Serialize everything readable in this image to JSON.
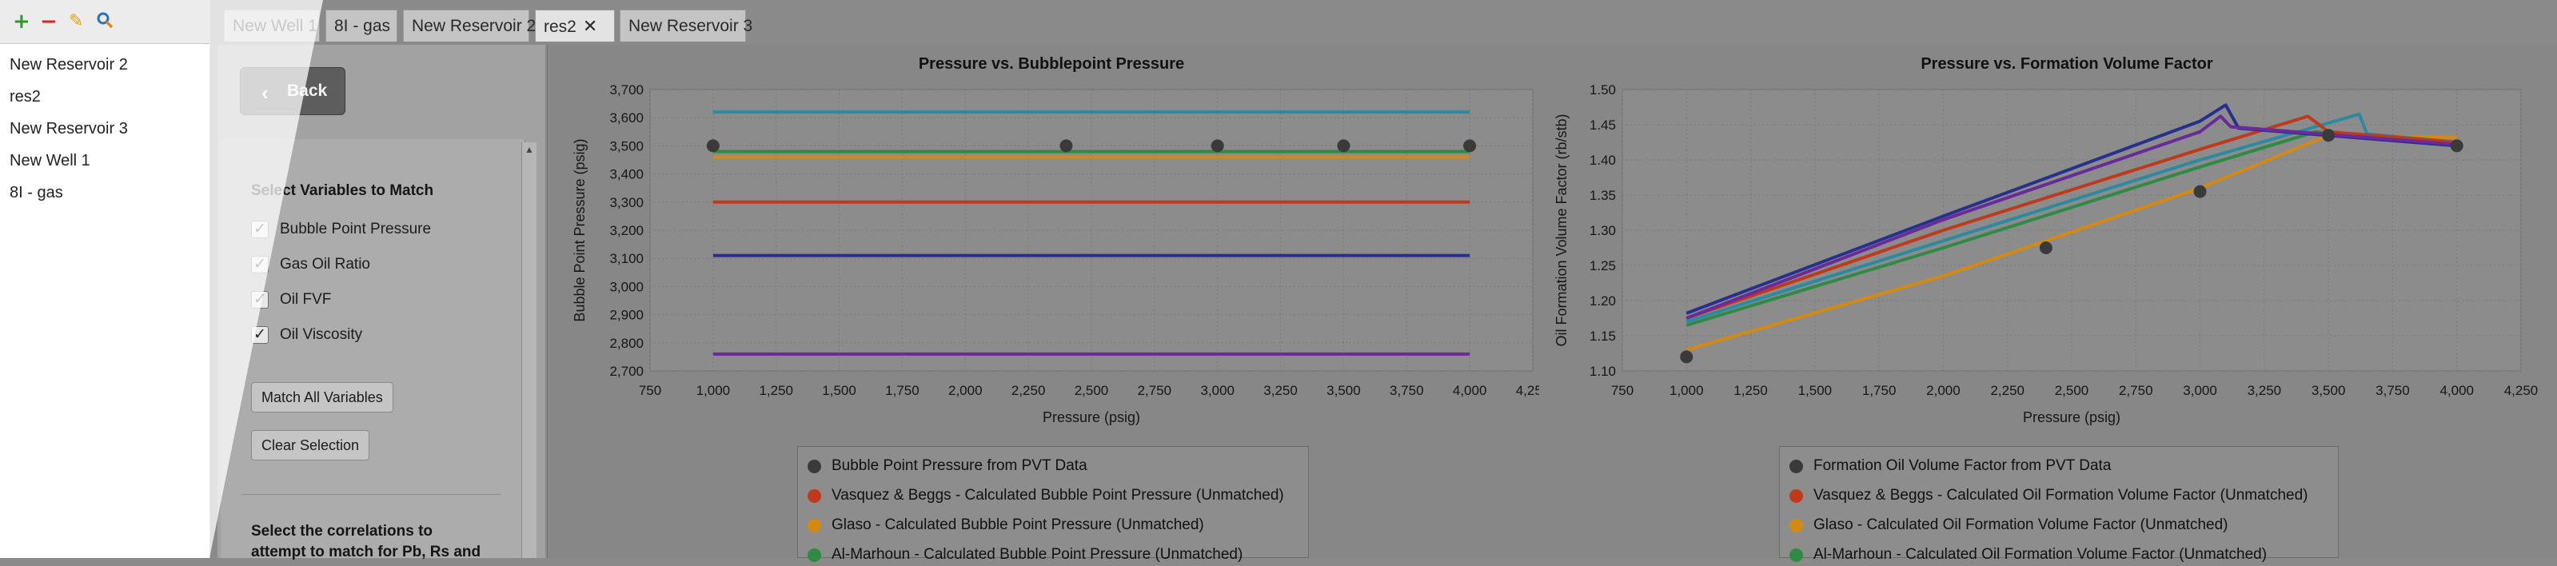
{
  "toolbar": {
    "add_icon": "plus-icon",
    "remove_icon": "minus-icon",
    "edit_icon": "pencil-icon",
    "search_icon": "search-icon"
  },
  "tree": {
    "items": [
      "New Reservoir 2",
      "res2",
      "New Reservoir 3",
      "New Well 1",
      "8I - gas"
    ]
  },
  "tabs": [
    {
      "label": "New Well 1",
      "active": false
    },
    {
      "label": "8I - gas",
      "active": false
    },
    {
      "label": "New Reservoir 2",
      "active": false
    },
    {
      "label": "res2",
      "active": true,
      "close": "✕"
    },
    {
      "label": "New Reservoir 3",
      "active": false
    }
  ],
  "side": {
    "back_label": "Back",
    "select_title": "Select Variables to Match",
    "checkboxes": [
      {
        "label": "Bubble Point Pressure",
        "checked": true
      },
      {
        "label": "Gas Oil Ratio",
        "checked": true
      },
      {
        "label": "Oil FVF",
        "checked": true
      },
      {
        "label": "Oil Viscosity",
        "checked": true
      }
    ],
    "match_all_label": "Match All Variables",
    "clear_label": "Clear Selection",
    "correlations_title_1": "Select the correlations to",
    "correlations_title_2": "attempt to match for Pb, Rs and"
  },
  "colors": {
    "pvt": "#3a3a3a",
    "vasquez": "#c0391b",
    "glaso": "#d48a12",
    "al_marhoun": "#2f8a45",
    "standing": "#2c8aa0",
    "lasater": "#27308d",
    "petrosky": "#6a2a9a"
  },
  "chart_data": [
    {
      "type": "line",
      "title": "Pressure vs. Bubblepoint Pressure",
      "xlabel": "Pressure (psig)",
      "ylabel": "Bubble Point Pressure (psig)",
      "xlim": [
        750,
        4250
      ],
      "ylim": [
        2700,
        3700
      ],
      "xticks": [
        750,
        1000,
        1250,
        1500,
        1750,
        2000,
        2250,
        2500,
        2750,
        3000,
        3250,
        3500,
        3750,
        4000,
        4250
      ],
      "yticks": [
        2700,
        2800,
        2900,
        3000,
        3100,
        3200,
        3300,
        3400,
        3500,
        3600,
        3700
      ],
      "grid": true,
      "points": {
        "name": "Bubble Point Pressure from PVT Data",
        "x": [
          1000,
          2400,
          3000,
          3500,
          4000
        ],
        "y": [
          3500,
          3500,
          3500,
          3500,
          3500
        ]
      },
      "series": [
        {
          "color_key": "standing",
          "x": [
            1000,
            4000
          ],
          "y": [
            3620,
            3620
          ]
        },
        {
          "color_key": "al_marhoun",
          "x": [
            1000,
            4000
          ],
          "y": [
            3480,
            3480
          ]
        },
        {
          "color_key": "glaso",
          "x": [
            1000,
            4000
          ],
          "y": [
            3460,
            3460
          ]
        },
        {
          "color_key": "vasquez",
          "x": [
            1000,
            4000
          ],
          "y": [
            3300,
            3300
          ]
        },
        {
          "color_key": "lasater",
          "x": [
            1000,
            4000
          ],
          "y": [
            3110,
            3110
          ]
        },
        {
          "color_key": "petrosky",
          "x": [
            1000,
            4000
          ],
          "y": [
            2760,
            2760
          ]
        }
      ],
      "legend": [
        {
          "label": "Bubble Point Pressure from PVT Data",
          "color_key": "pvt"
        },
        {
          "label": "Vasquez & Beggs - Calculated Bubble Point Pressure (Unmatched)",
          "color_key": "vasquez"
        },
        {
          "label": "Glaso - Calculated Bubble Point Pressure (Unmatched)",
          "color_key": "glaso"
        },
        {
          "label": "Al-Marhoun - Calculated Bubble Point Pressure (Unmatched)",
          "color_key": "al_marhoun"
        }
      ]
    },
    {
      "type": "line",
      "title": "Pressure vs. Formation Volume Factor",
      "xlabel": "Pressure (psig)",
      "ylabel": "Oil Formation Volume Factor (rb/stb)",
      "xlim": [
        750,
        4250
      ],
      "ylim": [
        1.1,
        1.5
      ],
      "xticks": [
        750,
        1000,
        1250,
        1500,
        1750,
        2000,
        2250,
        2500,
        2750,
        3000,
        3250,
        3500,
        3750,
        4000,
        4250
      ],
      "yticks": [
        1.1,
        1.15,
        1.2,
        1.25,
        1.3,
        1.35,
        1.4,
        1.45,
        1.5
      ],
      "grid": true,
      "points": {
        "name": "Formation Oil Volume Factor from PVT Data",
        "x": [
          1000,
          2400,
          3000,
          3500,
          4000
        ],
        "y": [
          1.12,
          1.275,
          1.355,
          1.435,
          1.42
        ]
      },
      "series": [
        {
          "color_key": "glaso",
          "x": [
            1000,
            2000,
            3000,
            3500,
            4000
          ],
          "y": [
            1.13,
            1.235,
            1.36,
            1.435,
            1.432
          ]
        },
        {
          "color_key": "al_marhoun",
          "x": [
            1000,
            2000,
            3000,
            3450,
            4000
          ],
          "y": [
            1.165,
            1.275,
            1.39,
            1.44,
            1.42
          ]
        },
        {
          "color_key": "standing",
          "x": [
            1000,
            2000,
            3000,
            3620,
            3650,
            4000
          ],
          "y": [
            1.17,
            1.285,
            1.4,
            1.465,
            1.437,
            1.425
          ]
        },
        {
          "color_key": "vasquez",
          "x": [
            1000,
            2000,
            3000,
            3420,
            3500,
            4000
          ],
          "y": [
            1.175,
            1.3,
            1.415,
            1.462,
            1.44,
            1.425
          ]
        },
        {
          "color_key": "lasater",
          "x": [
            1000,
            2000,
            3000,
            3100,
            3150,
            4000
          ],
          "y": [
            1.182,
            1.32,
            1.455,
            1.478,
            1.445,
            1.42
          ]
        },
        {
          "color_key": "petrosky",
          "x": [
            1000,
            2000,
            3000,
            3080,
            3120,
            4000
          ],
          "y": [
            1.175,
            1.315,
            1.44,
            1.462,
            1.447,
            1.422
          ]
        }
      ],
      "legend": [
        {
          "label": "Formation Oil Volume Factor from PVT Data",
          "color_key": "pvt"
        },
        {
          "label": "Vasquez & Beggs - Calculated Oil Formation Volume Factor (Unmatched)",
          "color_key": "vasquez"
        },
        {
          "label": "Glaso - Calculated Oil Formation Volume Factor (Unmatched)",
          "color_key": "glaso"
        },
        {
          "label": "Al-Marhoun - Calculated Oil Formation Volume Factor (Unmatched)",
          "color_key": "al_marhoun"
        }
      ]
    }
  ]
}
